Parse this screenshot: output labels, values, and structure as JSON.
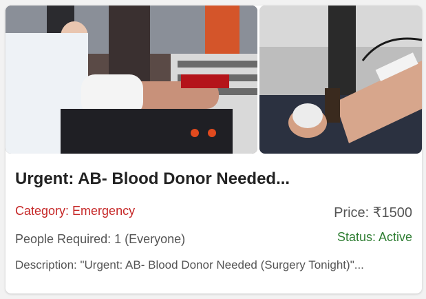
{
  "card": {
    "images": [
      {
        "icon": "blood-donation-photo"
      },
      {
        "icon": "arm-donating-photo"
      }
    ],
    "title": "Urgent: AB- Blood Donor Needed...",
    "category": "Category: Emergency",
    "price": "Price: ₹1500",
    "people_required": "People Required: 1 (Everyone)",
    "status": "Status: Active",
    "description": "Description: \"Urgent: AB- Blood Donor Needed (Surgery Tonight)\"..."
  },
  "colors": {
    "category": "#c62828",
    "status": "#2e7d32",
    "title": "#222222",
    "muted": "#555555"
  }
}
